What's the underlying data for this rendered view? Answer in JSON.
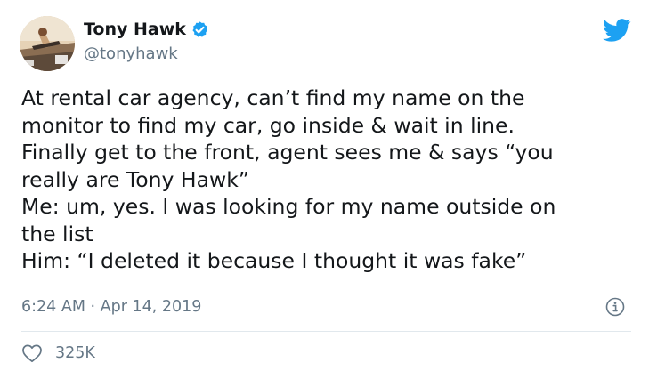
{
  "author": {
    "display_name": "Tony Hawk",
    "handle": "@tonyhawk"
  },
  "tweet": {
    "text": "At rental car agency, can’t find my name on the\nmonitor to find my car, go inside & wait in line.\nFinally get to the front, agent sees me & says “you\nreally are Tony Hawk”\nMe: um, yes. I was looking for my name outside on\nthe list\nHim: “I deleted it because I thought it was fake”",
    "timestamp": "6:24 AM · Apr 14, 2019",
    "likes": "325K"
  },
  "icons": {
    "brand": "twitter-bird-icon",
    "verified": "verified-badge-icon",
    "info": "info-icon",
    "like": "heart-icon"
  },
  "colors": {
    "twitter_blue": "#1da1f2",
    "text_primary": "#14171a",
    "text_secondary": "#657786",
    "divider": "#e1e8ed"
  }
}
